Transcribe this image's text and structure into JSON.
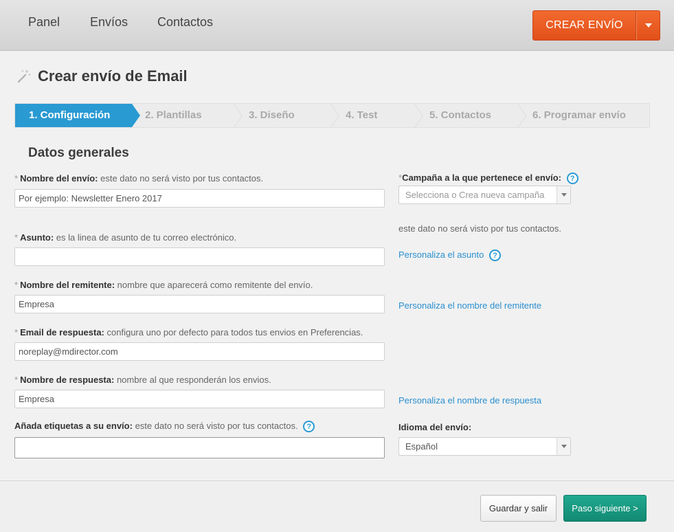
{
  "nav": {
    "items": [
      "Panel",
      "Envíos",
      "Contactos"
    ],
    "create_button": "CREAR ENVÍO"
  },
  "page": {
    "title": "Crear envío de Email"
  },
  "steps": [
    {
      "label": "1. Configuración",
      "active": true
    },
    {
      "label": "2. Plantillas",
      "active": false
    },
    {
      "label": "3. Diseño",
      "active": false
    },
    {
      "label": "4. Test",
      "active": false
    },
    {
      "label": "5. Contactos",
      "active": false
    },
    {
      "label": "6. Programar envío",
      "active": false
    }
  ],
  "section": {
    "title": "Datos generales"
  },
  "fields": {
    "nombre_envio": {
      "label": "Nombre del envío:",
      "hint": "este dato no será visto por tus contactos.",
      "placeholder": "Por ejemplo: Newsletter Enero 2017",
      "value": ""
    },
    "asunto": {
      "label": "Asunto:",
      "hint": "es la linea de asunto de tu correo electrónico.",
      "value": ""
    },
    "nombre_remitente": {
      "label": "Nombre del remitente:",
      "hint": "nombre que aparecerá como remitente del envío.",
      "value": "Empresa"
    },
    "email_respuesta": {
      "label": "Email de respuesta:",
      "hint": "configura uno por defecto para todos tus envios en Preferencias.",
      "value": "noreplay@mdirector.com"
    },
    "nombre_respuesta": {
      "label": "Nombre de respuesta:",
      "hint": "nombre al que responderán los envios.",
      "value": "Empresa"
    },
    "etiquetas": {
      "label": "Añada etiquetas a su envío:",
      "hint": "este dato no será visto por tus contactos.",
      "value": ""
    }
  },
  "required_marker": "*",
  "help_glyph": "?",
  "campaign": {
    "label": "Campaña a la que pertenece el envío:",
    "placeholder": "Selecciona o Crea nueva campaña",
    "note": "este dato no será visto por tus contactos."
  },
  "links": {
    "personaliza_asunto": "Personaliza el asunto",
    "personaliza_remitente": "Personaliza el nombre del remitente",
    "personaliza_respuesta": "Personaliza el nombre de respuesta"
  },
  "language": {
    "label": "Idioma del envío:",
    "value": "Español"
  },
  "footer": {
    "save_label": "Guardar y salir",
    "next_label": "Paso siguiente >"
  },
  "colors": {
    "accent_orange": "#e85a20",
    "step_active": "#2a9ad3",
    "next_button": "#179a81",
    "link": "#2a8fcf"
  }
}
